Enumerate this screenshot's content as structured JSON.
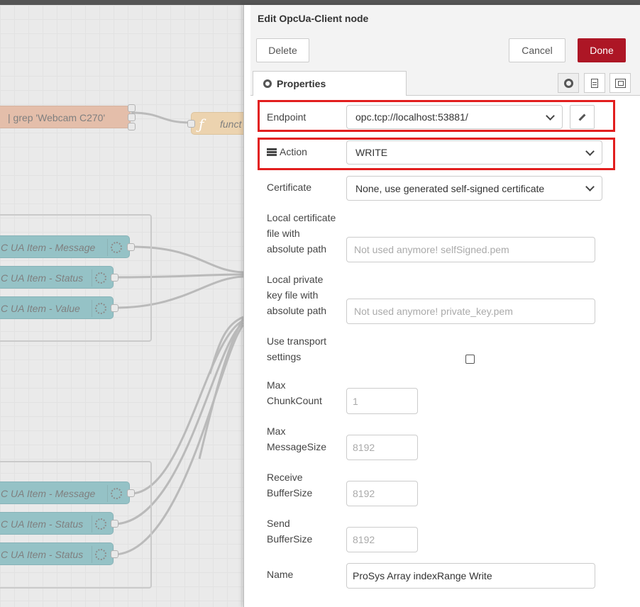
{
  "workspace": {
    "exec_node_label": "| grep 'Webcam C270'",
    "function_node_label": "funct",
    "top_group_nodes": [
      {
        "label": "C UA Item - Message"
      },
      {
        "label": "C UA Item - Status"
      },
      {
        "label": "C UA Item - Value"
      }
    ],
    "bottom_group_nodes": [
      {
        "label": "C UA Item - Message"
      },
      {
        "label": "C UA Item - Status"
      },
      {
        "label": "C UA Item - Status"
      }
    ]
  },
  "tray": {
    "title": "Edit OpcUa-Client node",
    "delete_label": "Delete",
    "cancel_label": "Cancel",
    "done_label": "Done",
    "properties_tab_label": "Properties"
  },
  "form": {
    "endpoint": {
      "label": "Endpoint",
      "value": "opc.tcp://localhost:53881/"
    },
    "action": {
      "label": "Action",
      "value": "WRITE"
    },
    "certificate": {
      "label": "Certificate",
      "value": "None, use generated self-signed certificate"
    },
    "local_cert": {
      "label_lines": [
        "Local certificate",
        "file with",
        "absolute path"
      ],
      "placeholder": "Not used anymore! selfSigned.pem"
    },
    "local_key": {
      "label_lines": [
        "Local private",
        "key file with",
        "absolute path"
      ],
      "placeholder": "Not used anymore! private_key.pem"
    },
    "transport": {
      "label_lines": [
        "Use transport",
        "settings"
      ],
      "checked": false
    },
    "max_chunk": {
      "label_lines": [
        "Max",
        "ChunkCount"
      ],
      "placeholder": "1"
    },
    "max_message": {
      "label_lines": [
        "Max",
        "MessageSize"
      ],
      "placeholder": "8192"
    },
    "receive_buffer": {
      "label_lines": [
        "Receive",
        "BufferSize"
      ],
      "placeholder": "8192"
    },
    "send_buffer": {
      "label_lines": [
        "Send",
        "BufferSize"
      ],
      "placeholder": "8192"
    },
    "name": {
      "label": "Name",
      "value": "ProSys Array indexRange Write"
    }
  },
  "colors": {
    "done": "#ad1625",
    "highlight": "#e21e1e",
    "opc_node": "#72aeb3"
  }
}
